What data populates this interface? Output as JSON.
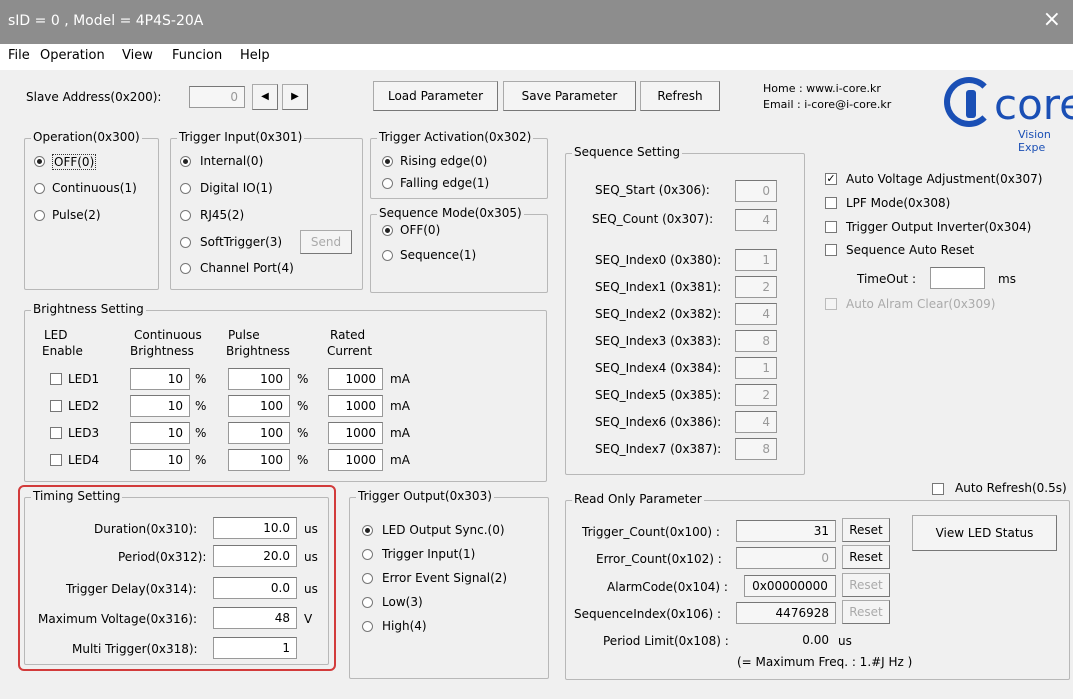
{
  "window": {
    "title": "sID = 0 , Model = 4P4S-20A",
    "close": "×"
  },
  "menu": [
    "File",
    "Operation",
    "View",
    "Funcion",
    "Help"
  ],
  "toolbar": {
    "slave_label": "Slave Address(0x200):",
    "slave_value": "0",
    "prev": "◀",
    "next": "▶",
    "load": "Load Parameter",
    "save": "Save Parameter",
    "refresh": "Refresh",
    "home": "Home : www.i-core.kr",
    "email": "Email : i-core@i-core.kr",
    "logo_text": "core",
    "logo_sub": "Vision Expe"
  },
  "operation": {
    "title": "Operation(0x300)",
    "items": [
      "OFF(0)",
      "Continuous(1)",
      "Pulse(2)"
    ],
    "selected": 0
  },
  "trigger_input": {
    "title": "Trigger Input(0x301)",
    "items": [
      "Internal(0)",
      "Digital IO(1)",
      "RJ45(2)",
      "SoftTrigger(3)",
      "Channel Port(4)"
    ],
    "selected": 0,
    "send": "Send"
  },
  "trigger_activation": {
    "title": "Trigger Activation(0x302)",
    "items": [
      "Rising edge(0)",
      "Falling edge(1)"
    ],
    "selected": 0
  },
  "sequence_mode": {
    "title": "Sequence Mode(0x305)",
    "items": [
      "OFF(0)",
      "Sequence(1)"
    ],
    "selected": 0
  },
  "sequence": {
    "title": "Sequence Setting",
    "start_label": "SEQ_Start (0x306):",
    "start": "0",
    "count_label": "SEQ_Count (0x307):",
    "count": "4",
    "index_labels": [
      "SEQ_Index0 (0x380):",
      "SEQ_Index1 (0x381):",
      "SEQ_Index2 (0x382):",
      "SEQ_Index3 (0x383):",
      "SEQ_Index4 (0x384):",
      "SEQ_Index5 (0x385):",
      "SEQ_Index6 (0x386):",
      "SEQ_Index7 (0x387):"
    ],
    "index_values": [
      "1",
      "2",
      "4",
      "8",
      "1",
      "2",
      "4",
      "8"
    ]
  },
  "options": {
    "auto_voltage": "Auto Voltage Adjustment(0x307)",
    "lpf": "LPF Mode(0x308)",
    "trig_inv": "Trigger Output Inverter(0x304)",
    "seq_reset": "Sequence Auto Reset",
    "timeout_label": "TimeOut :",
    "timeout_unit": "ms",
    "timeout_value": "",
    "auto_alarm": "Auto Alram Clear(0x309)"
  },
  "brightness": {
    "title": "Brightness Setting",
    "headers": [
      [
        "LED",
        "Enable"
      ],
      [
        "Continuous",
        "Brightness"
      ],
      [
        "Pulse",
        "Brightness"
      ],
      [
        "Rated",
        "Current"
      ]
    ],
    "rows": [
      {
        "led": "LED1",
        "cont": "10",
        "pulse": "100",
        "rated": "1000"
      },
      {
        "led": "LED2",
        "cont": "10",
        "pulse": "100",
        "rated": "1000"
      },
      {
        "led": "LED3",
        "cont": "10",
        "pulse": "100",
        "rated": "1000"
      },
      {
        "led": "LED4",
        "cont": "10",
        "pulse": "100",
        "rated": "1000"
      }
    ],
    "pct": "%",
    "ma": "mA"
  },
  "timing": {
    "title": "Timing Setting",
    "rows": [
      {
        "label": "Duration(0x310):",
        "value": "10.0",
        "unit": "us"
      },
      {
        "label": "Period(0x312):",
        "value": "20.0",
        "unit": "us"
      },
      {
        "label": "Trigger Delay(0x314):",
        "value": "0.0",
        "unit": "us"
      },
      {
        "label": "Maximum Voltage(0x316):",
        "value": "48",
        "unit": "V"
      },
      {
        "label": "Multi Trigger(0x318):",
        "value": "1",
        "unit": ""
      }
    ]
  },
  "trigger_output": {
    "title": "Trigger Output(0x303)",
    "items": [
      "LED Output Sync.(0)",
      "Trigger Input(1)",
      "Error Event Signal(2)",
      "Low(3)",
      "High(4)"
    ],
    "selected": 0
  },
  "readonly": {
    "title": "Read Only Parameter",
    "auto_refresh": "Auto Refresh(0.5s)",
    "rows": [
      {
        "label": "Trigger_Count(0x100) :",
        "value": "31",
        "reset": "Reset"
      },
      {
        "label": "Error_Count(0x102) :",
        "value": "0",
        "reset": "Reset"
      },
      {
        "label": "AlarmCode(0x104) :",
        "value": "0x00000000",
        "reset": "Reset"
      },
      {
        "label": "SequenceIndex(0x106) :",
        "value": "4476928",
        "reset": "Reset"
      }
    ],
    "period_label": "Period Limit(0x108) :",
    "period_value": "0.00",
    "period_unit": "us",
    "freq_note": "(= Maximum Freq. : 1.#J Hz )",
    "view_led": "View LED Status"
  }
}
